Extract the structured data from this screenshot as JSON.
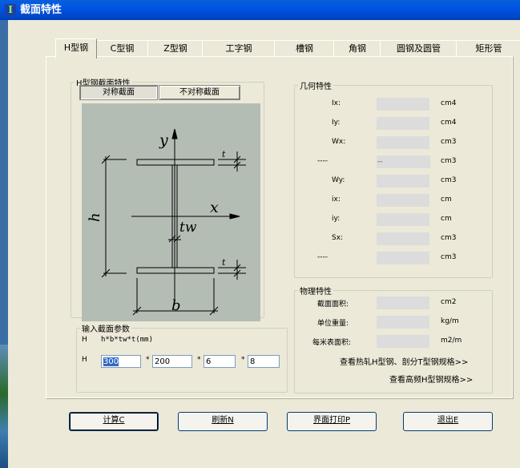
{
  "window": {
    "title": "截面特性"
  },
  "tabs": [
    "H型钢",
    "C型钢",
    "Z型钢",
    "工字钢",
    "槽钢",
    "角钢",
    "圆钢及圆管",
    "矩形管"
  ],
  "section": {
    "legend": "H型钢截面特性",
    "sym_label": "对称截面",
    "asym_label": "不对称截面"
  },
  "diagram_labels": {
    "y": "y",
    "x": "x",
    "h": "h",
    "b": "b",
    "tw": "tw",
    "t1": "t",
    "t2": "t"
  },
  "geometry": {
    "legend": "几何特性",
    "rows": [
      {
        "label": "Ix:",
        "value": "",
        "unit": "cm4"
      },
      {
        "label": "Iy:",
        "value": "",
        "unit": "cm4"
      },
      {
        "label": "Wx:",
        "value": "",
        "unit": "cm3"
      },
      {
        "label": "----",
        "value": "--",
        "unit": "cm3"
      },
      {
        "label": "Wy:",
        "value": "",
        "unit": "cm3"
      },
      {
        "label": "ix:",
        "value": "",
        "unit": "cm"
      },
      {
        "label": "iy:",
        "value": "",
        "unit": "cm"
      },
      {
        "label": "Sx:",
        "value": "",
        "unit": "cm3"
      },
      {
        "label": "----",
        "value": "",
        "unit": "cm3"
      }
    ]
  },
  "physical": {
    "legend": "物理特性",
    "rows": [
      {
        "label": "截面面积:",
        "value": "",
        "unit": "cm2"
      },
      {
        "label": "单位重量:",
        "value": "",
        "unit": "kg/m"
      },
      {
        "label": "每米表面积:",
        "value": "",
        "unit": "m2/m"
      }
    ],
    "link1": "查看热轧H型钢、剖分T型钢规格>>",
    "link2": "查看高频H型钢规格>>"
  },
  "input": {
    "legend": "输入截面参数",
    "row1_label": "H",
    "formula": "h*b*tw*t(mm)",
    "row2_label": "H",
    "h": "300",
    "b": "200",
    "tw": "6",
    "t": "8",
    "sep": "*"
  },
  "buttons": {
    "calc": "计算C",
    "refresh": "刷新N",
    "print": "界面打印P",
    "exit": "退出E"
  }
}
